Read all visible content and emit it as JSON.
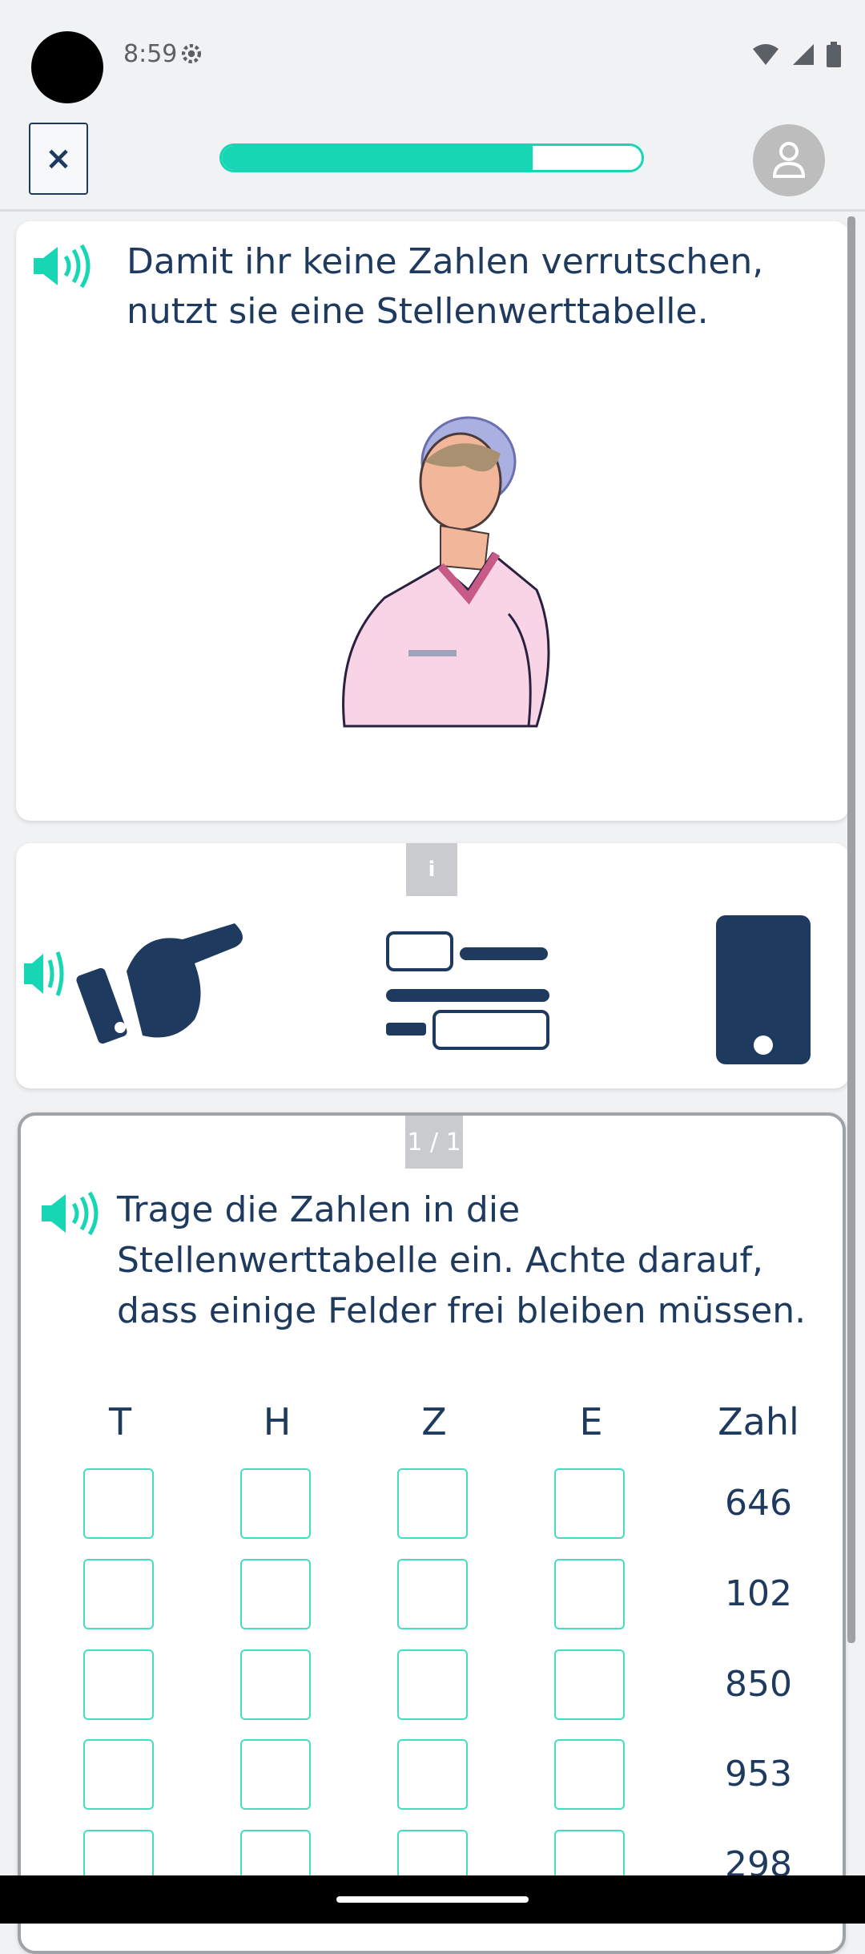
{
  "status_bar": {
    "time": "8:59"
  },
  "top_bar": {
    "close_label": "×",
    "progress_percent": 74
  },
  "card1": {
    "text": "Damit ihr keine Zahlen verrutschen, nutzt sie eine Stellenwerttabelle."
  },
  "card2": {
    "info_label": "i"
  },
  "task": {
    "page_indicator": "1 / 1",
    "instruction": "Trage die Zahlen in die Stellenwerttabelle ein. Achte darauf, dass einige Felder frei bleiben müssen.",
    "columns": [
      "T",
      "H",
      "Z",
      "E",
      "Zahl"
    ],
    "rows": [
      {
        "zahl": "646"
      },
      {
        "zahl": "102"
      },
      {
        "zahl": "850"
      },
      {
        "zahl": "953"
      },
      {
        "zahl": "298"
      }
    ]
  },
  "colors": {
    "accent": "#16d6b4",
    "text": "#1e3a5f",
    "speaker": "#16d6b4"
  }
}
